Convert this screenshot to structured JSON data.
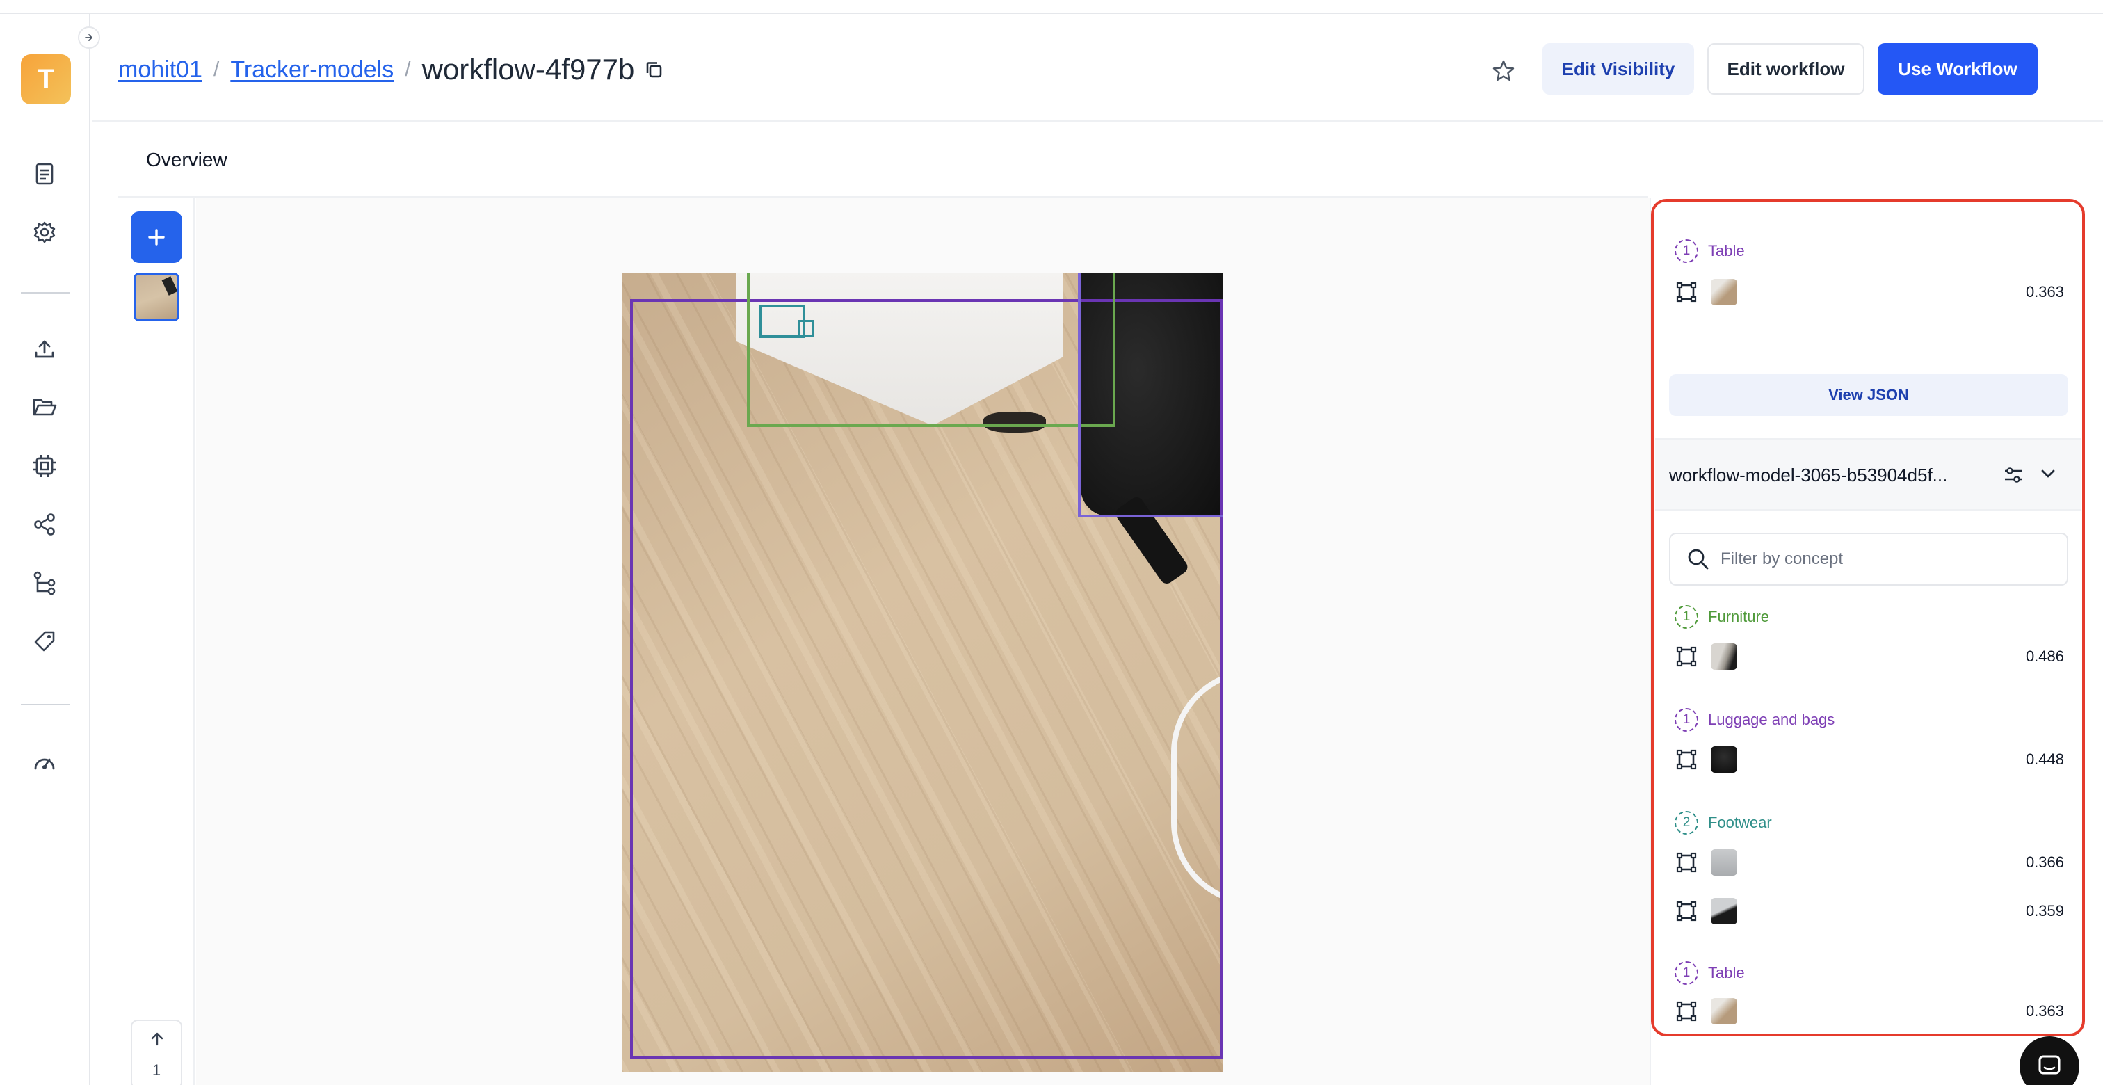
{
  "app": {
    "logo_letter": "T"
  },
  "sidebar": {
    "items": [
      {
        "icon": "document-icon"
      },
      {
        "icon": "gear-icon"
      },
      {
        "icon": "upload-icon"
      },
      {
        "icon": "folder-icon"
      },
      {
        "icon": "chip-icon"
      },
      {
        "icon": "share-icon"
      },
      {
        "icon": "workflow-icon"
      },
      {
        "icon": "tag-icon"
      },
      {
        "icon": "gauge-icon"
      }
    ]
  },
  "header": {
    "breadcrumb": {
      "user": "mohit01",
      "app": "Tracker-models",
      "separator": "/",
      "current": "workflow-4f977b"
    },
    "buttons": {
      "edit_visibility": "Edit Visibility",
      "edit_workflow": "Edit workflow",
      "use_workflow": "Use Workflow"
    }
  },
  "tabs": {
    "overview": "Overview"
  },
  "viewer": {
    "page_number": "1"
  },
  "results": {
    "top_concept": {
      "badge": "1",
      "label": "Table",
      "score": "0.363",
      "color": "#7e3fb5"
    },
    "view_json_label": "View JSON",
    "model_name": "workflow-model-3065-b53904d5f...",
    "filter_placeholder": "Filter by concept",
    "concepts": [
      {
        "badge": "1",
        "label": "Furniture",
        "color": "#4f9a3a",
        "detections": [
          {
            "score": "0.486"
          }
        ]
      },
      {
        "badge": "1",
        "label": "Luggage and bags",
        "color": "#7e3fb5",
        "detections": [
          {
            "score": "0.448"
          }
        ]
      },
      {
        "badge": "2",
        "label": "Footwear",
        "color": "#2f8f89",
        "detections": [
          {
            "score": "0.366"
          },
          {
            "score": "0.359"
          }
        ]
      },
      {
        "badge": "1",
        "label": "Table",
        "color": "#7e3fb5",
        "detections": [
          {
            "score": "0.363"
          }
        ]
      }
    ]
  },
  "colors": {
    "primary": "#2457f5",
    "highlight": "#e53b2c",
    "box_table": "#6a35b3",
    "box_furniture": "#6aa84f",
    "box_luggage": "#7a63d6",
    "box_footwear": "#2f8f99"
  }
}
